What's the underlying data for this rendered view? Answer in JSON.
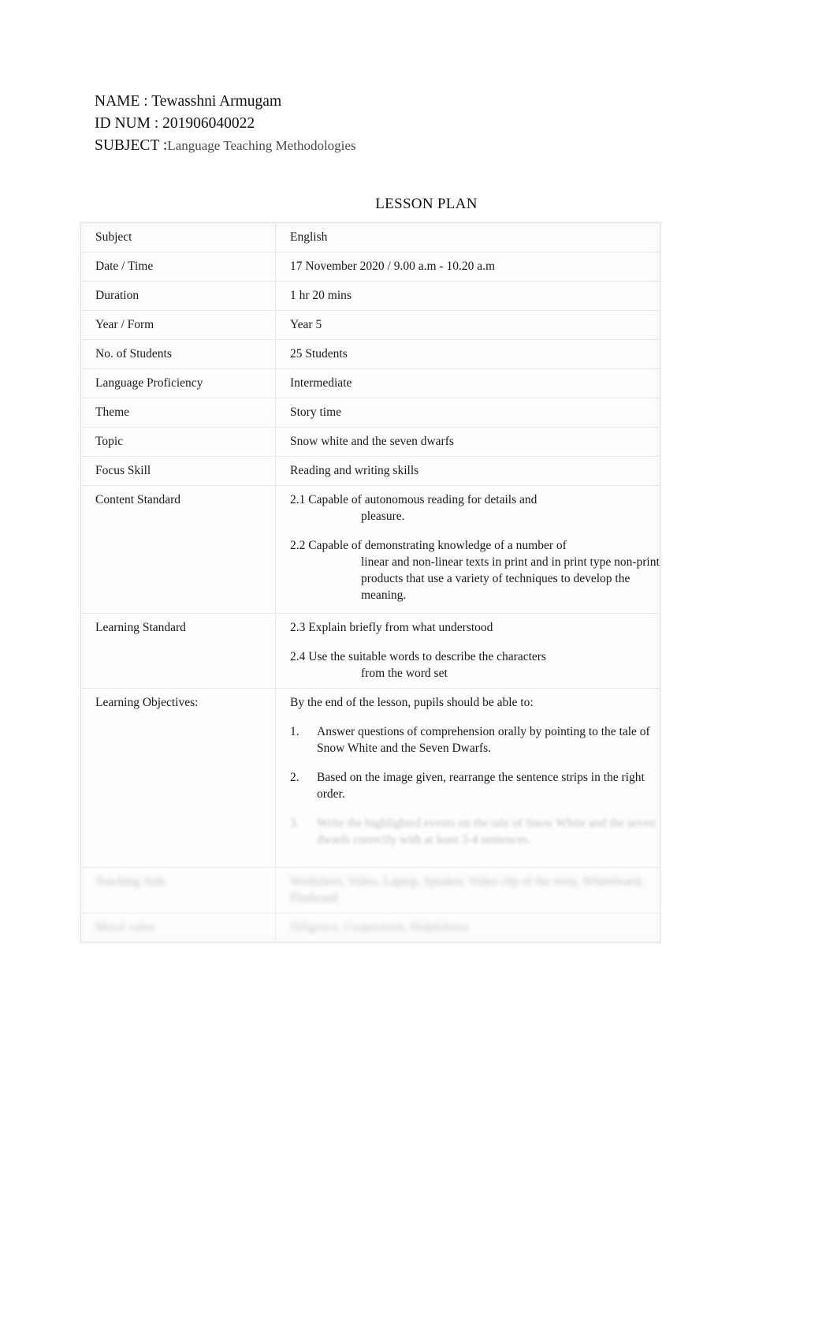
{
  "header": {
    "name_line": "NAME : Tewasshni Armugam",
    "id_line": "ID NUM : 201906040022",
    "subject_label": "SUBJECT :",
    "subject_value": "Language Teaching Methodologies"
  },
  "title": "LESSON PLAN",
  "table": {
    "rows": [
      {
        "key": "Subject",
        "value": "English"
      },
      {
        "key": "Date / Time",
        "value": "17 November 2020 / 9.00 a.m - 10.20 a.m"
      },
      {
        "key": "Duration",
        "value": "1 hr 20 mins"
      },
      {
        "key": "Year / Form",
        "value": "Year 5"
      },
      {
        "key": "No. of Students",
        "value": "25 Students"
      },
      {
        "key": "Language Proficiency",
        "value": "Intermediate"
      },
      {
        "key": "Theme",
        "value": "Story time"
      },
      {
        "key": "Topic",
        "value": "Snow white and the seven dwarfs"
      },
      {
        "key": "Focus Skill",
        "value": "Reading and writing skills"
      }
    ],
    "content_standard": {
      "key": "Content Standard",
      "item_1_lead": "2.1 Capable of autonomous reading for details and",
      "item_1_cont": "pleasure.",
      "item_2_lead": "2.2 Capable of demonstrating knowledge of a number of",
      "item_2_cont": "linear and non-linear texts in print and in print type non-print products that use a variety of techniques to develop the meaning."
    },
    "learning_standard": {
      "key": "Learning Standard",
      "item_1": "2.3 Explain briefly from what understood",
      "item_2_lead": "2.4 Use the suitable words to describe the characters",
      "item_2_cont": "from the word set"
    },
    "learning_objectives": {
      "key": "Learning Objectives:",
      "intro": "By the end of the lesson, pupils should be able to:",
      "items": [
        {
          "num": "1.",
          "text": "Answer questions of comprehension orally by pointing to the tale of Snow White and the Seven Dwarfs."
        },
        {
          "num": "2.",
          "text": "Based on the image given, rearrange the sentence strips in the right order."
        },
        {
          "num": "3.",
          "text": "Write the highlighted events on the tale of Snow White and the seven dwarfs correctly with at least 3-4 sentences."
        }
      ]
    },
    "teaching_aids": {
      "key": "Teaching Aids",
      "value": "Worksheet, Video, Laptop, Speaker, Video clip of the story, Whiteboard, Flashcard"
    },
    "moral_value": {
      "key": "Moral value",
      "value": "Diligence, Cooperation, Helpfulness"
    }
  }
}
